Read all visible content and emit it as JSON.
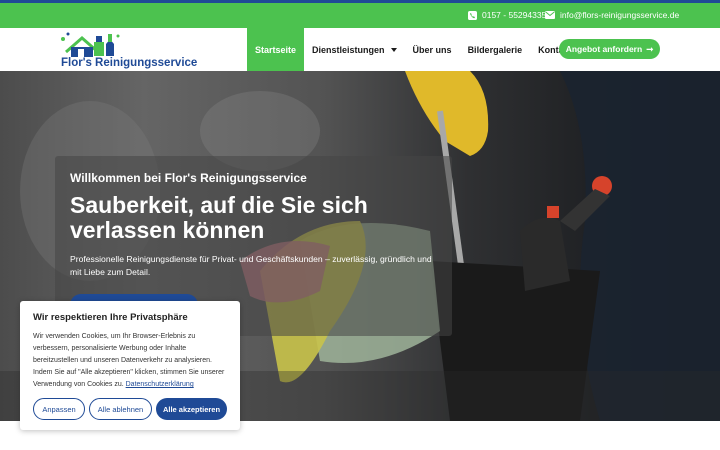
{
  "topbar": {
    "phone": "0157 - 55294335",
    "email": "info@flors-reinigungsservice.de",
    "phone_icon": "phone-icon",
    "email_icon": "envelope-icon"
  },
  "header": {
    "logo_text": "Flor's Reinigungsservice",
    "nav": [
      {
        "label": "Startseite"
      },
      {
        "label": "Dienstleistungen"
      },
      {
        "label": "Über uns"
      },
      {
        "label": "Bildergalerie"
      },
      {
        "label": "Kontakt"
      }
    ],
    "cta_label": "Angebot anfordern",
    "cta_arrow": "➞"
  },
  "hero": {
    "welcome": "Willkommen bei Flor's Reinigungsservice",
    "title": "Sauberkeit, auf die Sie sich verlassen können",
    "subtitle": "Professionelle Reinigungsdienste für Privat- und Geschäftskunden – zuverlässig, gründlich und mit Liebe zum Detail."
  },
  "cookie": {
    "title": "Wir respektieren Ihre Privatsphäre",
    "text": "Wir verwenden Cookies, um Ihr Browser-Erlebnis zu verbessern, personalisierte Werbung oder Inhalte bereitzustellen und unseren Datenverkehr zu analysieren. Indem Sie auf \"Alle akzeptieren\" klicken, stimmen Sie unserer Verwendung von Cookies zu.",
    "link": "Datenschutzerklärung",
    "customize": "Anpassen",
    "reject": "Alle ablehnen",
    "accept": "Alle akzeptieren"
  },
  "colors": {
    "green": "#4cc24f",
    "blue": "#1f4a96"
  }
}
